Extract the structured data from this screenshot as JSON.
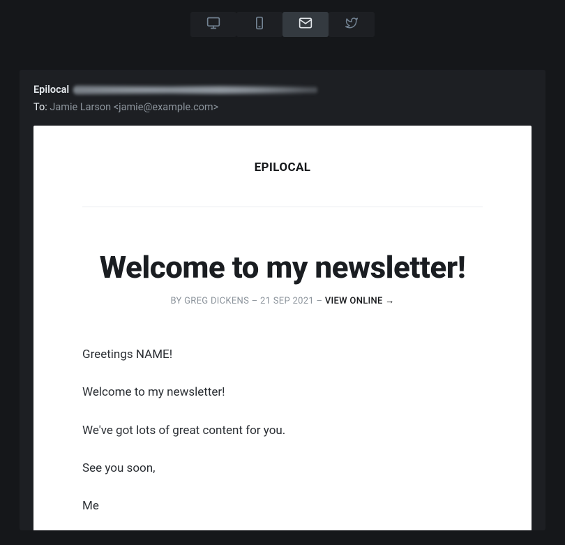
{
  "tabs": {
    "desktop": {
      "name": "desktop-preview",
      "active": false
    },
    "mobile": {
      "name": "mobile-preview",
      "active": false
    },
    "email": {
      "name": "email-preview",
      "active": true
    },
    "twitter": {
      "name": "twitter-preview",
      "active": false
    }
  },
  "email_header": {
    "from_name": "Epilocal",
    "to_label": "To:",
    "to_value": "Jamie Larson <jamie@example.com>"
  },
  "brand": "EPILOCAL",
  "post": {
    "title": "Welcome to my newsletter!",
    "byline_prefix": "BY ",
    "author": "GREG DICKENS",
    "sep1": " – ",
    "date": "21 SEP 2021",
    "sep2": " – ",
    "view_online": "VIEW ONLINE →"
  },
  "body": {
    "p1": "Greetings NAME!",
    "p2": "Welcome to my newsletter!",
    "p3": "We've got lots of great content for you.",
    "p4": "See you soon,",
    "p5": "Me"
  }
}
